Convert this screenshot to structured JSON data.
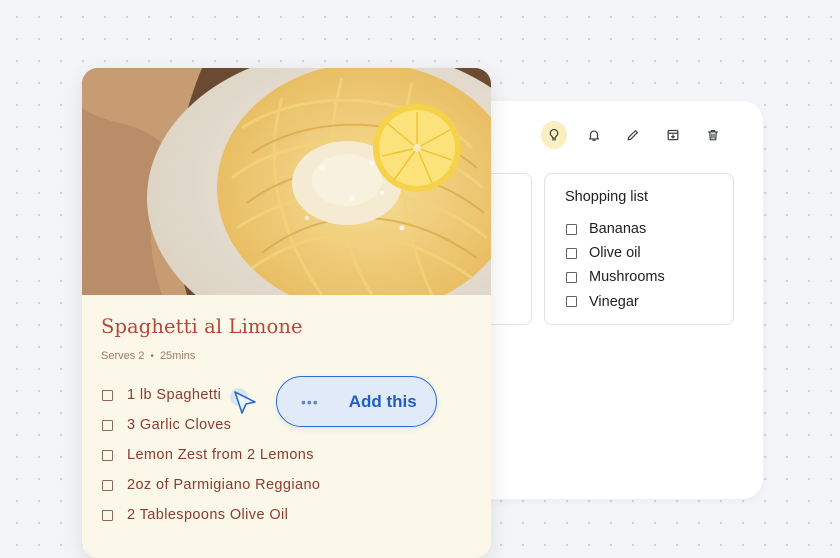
{
  "toolbar": {
    "buttons": [
      {
        "icon": "lightbulb-icon",
        "active": true
      },
      {
        "icon": "bell-icon",
        "active": false
      },
      {
        "icon": "pencil-icon",
        "active": false
      },
      {
        "icon": "archive-icon",
        "active": false
      },
      {
        "icon": "trash-icon",
        "active": false
      }
    ],
    "active_color": "#fbeec0"
  },
  "shopping_list": {
    "title": "Shopping list",
    "items": [
      "Bananas",
      "Olive oil",
      "Mushrooms",
      "Vinegar"
    ]
  },
  "recipe": {
    "title": "Spaghetti al Limone",
    "serves": "Serves 2",
    "separator": "•",
    "time": "25mins",
    "ingredients": [
      "1 lb Spaghetti",
      "3 Garlic Cloves",
      "Lemon Zest from 2 Lemons",
      "2oz of Parmigiano Reggiano",
      "2 Tablespoons Olive Oil"
    ],
    "title_color": "#b5473a"
  },
  "action": {
    "dots": "•••",
    "label": "Add this",
    "accent": "#2e6bd1"
  }
}
